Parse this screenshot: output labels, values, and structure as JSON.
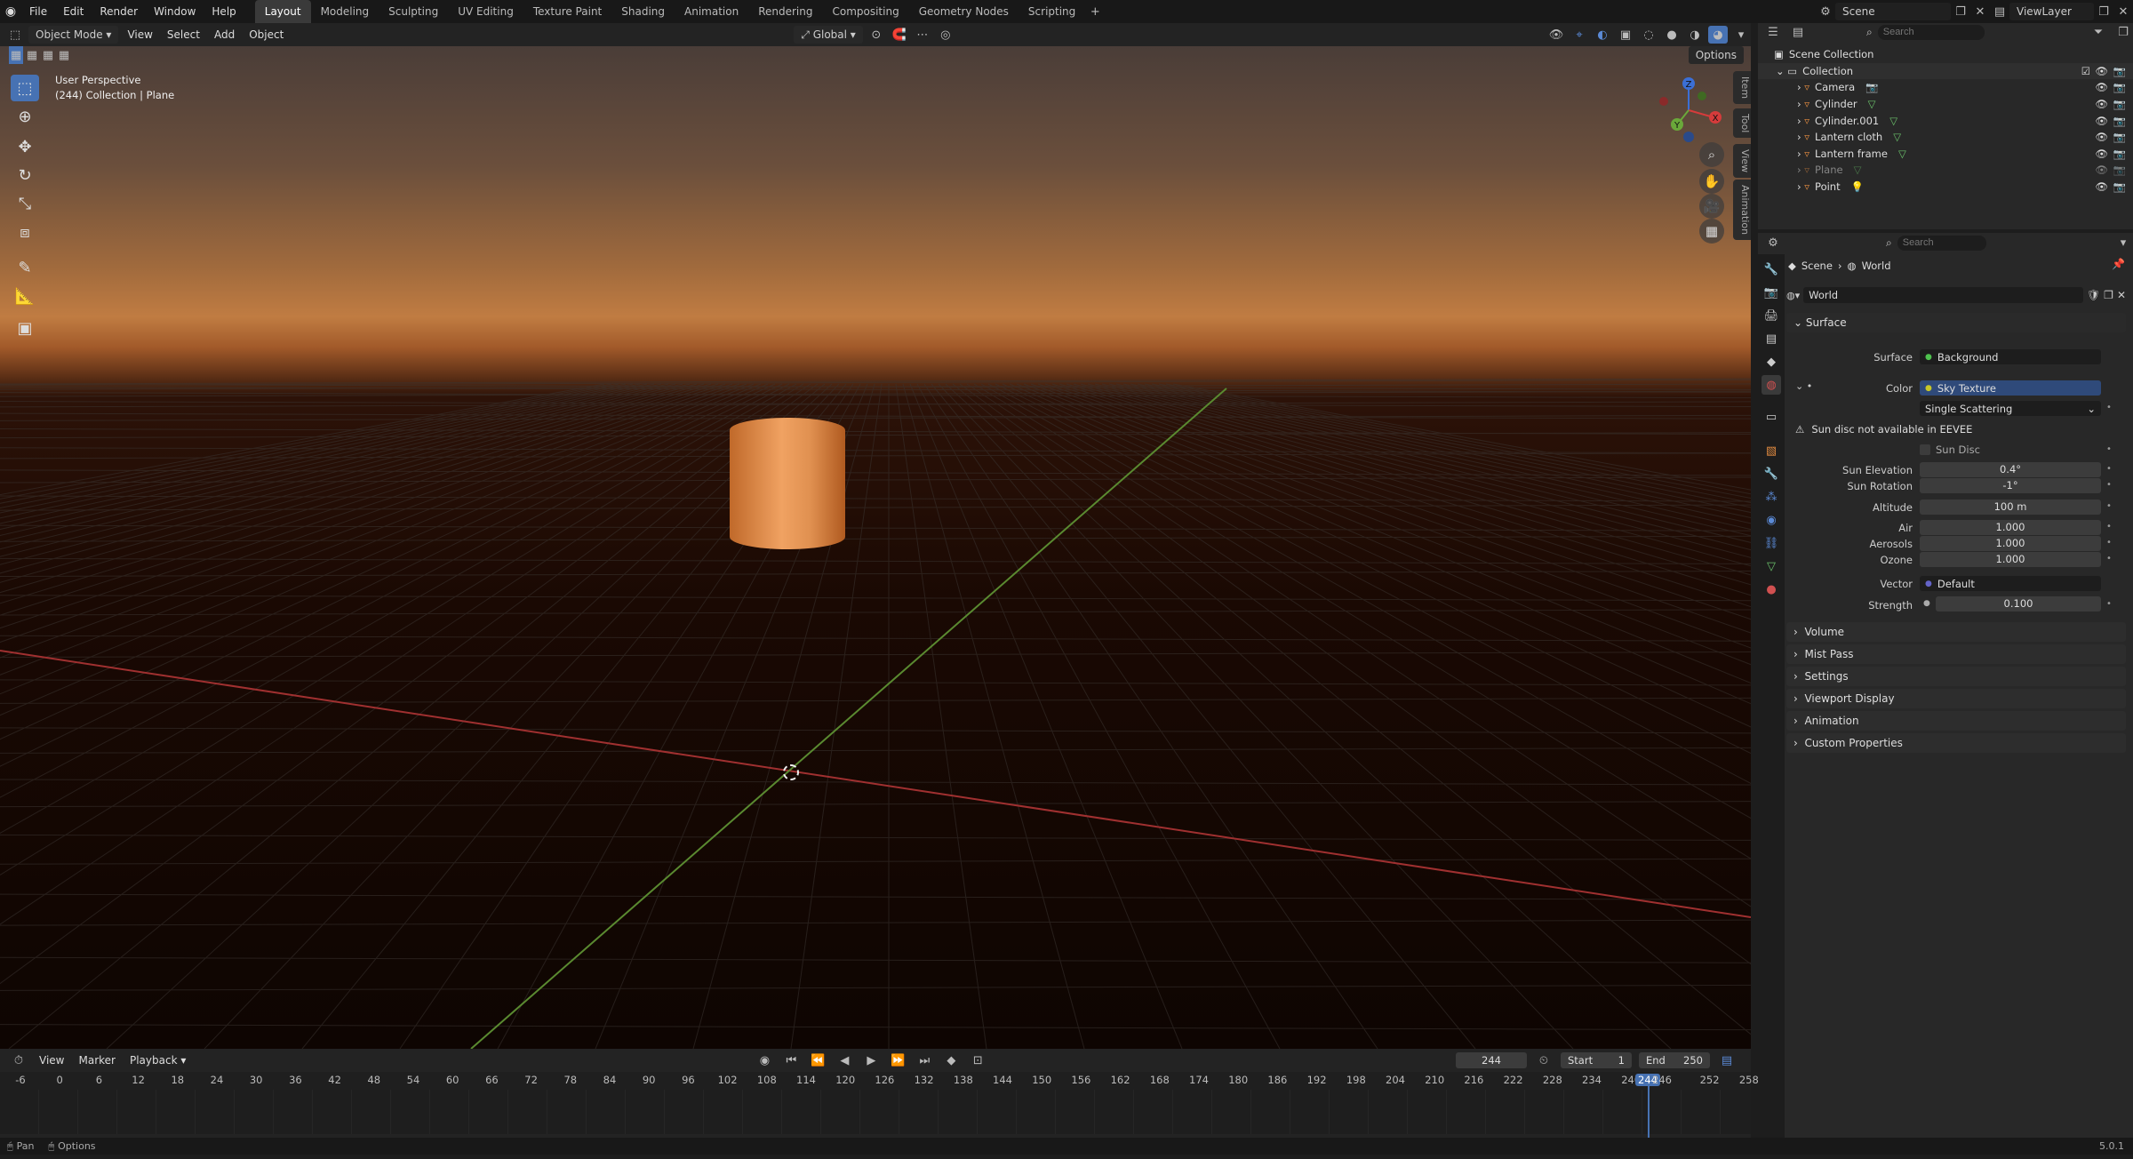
{
  "topbar": {
    "menus": [
      "File",
      "Edit",
      "Render",
      "Window",
      "Help"
    ],
    "workspaces": [
      "Layout",
      "Modeling",
      "Sculpting",
      "UV Editing",
      "Texture Paint",
      "Shading",
      "Animation",
      "Rendering",
      "Compositing",
      "Geometry Nodes",
      "Scripting"
    ],
    "active_workspace": "Layout",
    "scene": "Scene",
    "view_layer": "ViewLayer"
  },
  "viewport": {
    "mode": "Object Mode",
    "menus": [
      "View",
      "Select",
      "Add",
      "Object"
    ],
    "transform_orientation": "Global",
    "options_label": "Options",
    "info_line1": "User Perspective",
    "info_line2": "(244) Collection | Plane",
    "side_tabs": [
      "Item",
      "Tool",
      "View",
      "Animation"
    ],
    "gizmo_axes": {
      "x": "X",
      "y": "Y",
      "z": "Z"
    }
  },
  "outliner": {
    "search_placeholder": "Search",
    "scene_collection": "Scene Collection",
    "collection": "Collection",
    "items": [
      {
        "name": "Camera"
      },
      {
        "name": "Cylinder"
      },
      {
        "name": "Cylinder.001"
      },
      {
        "name": "Lantern cloth"
      },
      {
        "name": "Lantern frame"
      },
      {
        "name": "Plane"
      },
      {
        "name": "Point"
      }
    ]
  },
  "properties": {
    "search_placeholder": "Search",
    "breadcrumb": [
      "Scene",
      "World"
    ],
    "world_name": "World",
    "surface_panel": "Surface",
    "surface_label": "Surface",
    "surface_value": "Background",
    "color_label": "Color",
    "color_value": "Sky Texture",
    "sky_type": "Single Scattering",
    "warning": "Sun disc not available in EEVEE",
    "sun_disc": "Sun Disc",
    "fields": [
      {
        "label": "Sun Elevation",
        "value": "0.4°"
      },
      {
        "label": "Sun Rotation",
        "value": "-1°"
      },
      {
        "label": "Altitude",
        "value": "100 m"
      },
      {
        "label": "Air",
        "value": "1.000"
      },
      {
        "label": "Aerosols",
        "value": "1.000"
      },
      {
        "label": "Ozone",
        "value": "1.000"
      }
    ],
    "vector_label": "Vector",
    "vector_value": "Default",
    "strength_label": "Strength",
    "strength_value": "0.100",
    "panels": [
      "Volume",
      "Mist Pass",
      "Settings",
      "Viewport Display",
      "Animation",
      "Custom Properties"
    ]
  },
  "timeline": {
    "menus": [
      "View",
      "Marker",
      "Playback"
    ],
    "current_frame": "244",
    "start_label": "Start",
    "start_value": "1",
    "end_label": "End",
    "end_value": "250",
    "ticks": [
      "-6",
      "0",
      "6",
      "12",
      "18",
      "24",
      "30",
      "36",
      "42",
      "48",
      "54",
      "60",
      "66",
      "72",
      "78",
      "84",
      "90",
      "96",
      "102",
      "108",
      "114",
      "120",
      "126",
      "132",
      "138",
      "144",
      "150",
      "156",
      "162",
      "168",
      "174",
      "180",
      "186",
      "192",
      "198",
      "204",
      "210",
      "216",
      "222",
      "228",
      "234",
      "240",
      "244",
      "246",
      "252",
      "258"
    ]
  },
  "statusbar": {
    "left1": "Pan",
    "left2": "Options",
    "version": "5.0.1"
  }
}
